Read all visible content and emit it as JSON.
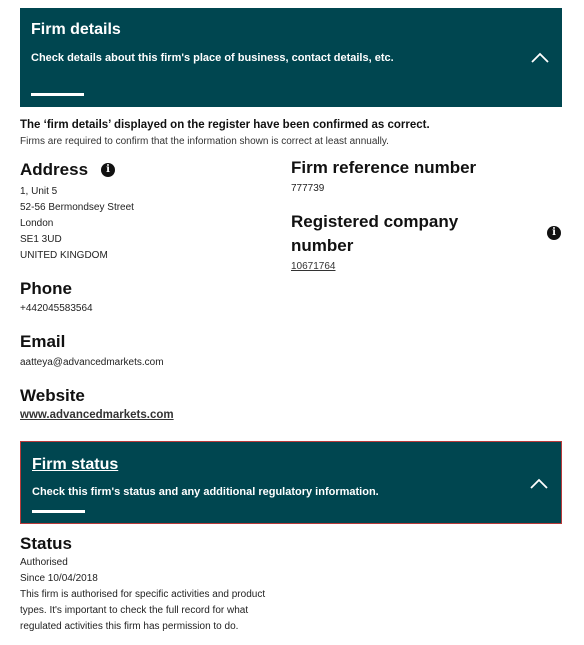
{
  "firm_details_panel": {
    "title": "Firm details",
    "description": "Check details about this firm's place of business, contact details, etc.",
    "chevron_icon": "chevron-up-icon"
  },
  "confirmation": {
    "strong": "The ‘firm details’ displayed on the register have been confirmed as correct.",
    "sub": "Firms are required to confirm that the information shown is correct at least annually."
  },
  "address": {
    "heading": "Address",
    "lines": [
      "1, Unit 5",
      "52-56 Bermondsey Street",
      "London",
      "SE1 3UD",
      "UNITED KINGDOM"
    ]
  },
  "phone": {
    "heading": "Phone",
    "value": "+442045583564"
  },
  "email": {
    "heading": "Email",
    "value": "aatteya@advancedmarkets.com"
  },
  "website": {
    "heading": "Website",
    "value": "www.advancedmarkets.com"
  },
  "frn": {
    "heading": "Firm reference number",
    "value": "777739"
  },
  "company": {
    "heading_line1": "Registered company",
    "heading_line2": "number",
    "value": "10671764"
  },
  "firm_status_panel": {
    "title": "Firm status",
    "description": "Check this firm's status and any additional regulatory information.",
    "chevron_icon": "chevron-up-icon"
  },
  "status": {
    "heading": "Status",
    "value": "Authorised",
    "since": "Since 10/04/2018",
    "note_lines": [
      "This firm is authorised for specific activities and product",
      "types. It's important to check the full record for what",
      "regulated activities this firm has permission to do."
    ]
  }
}
